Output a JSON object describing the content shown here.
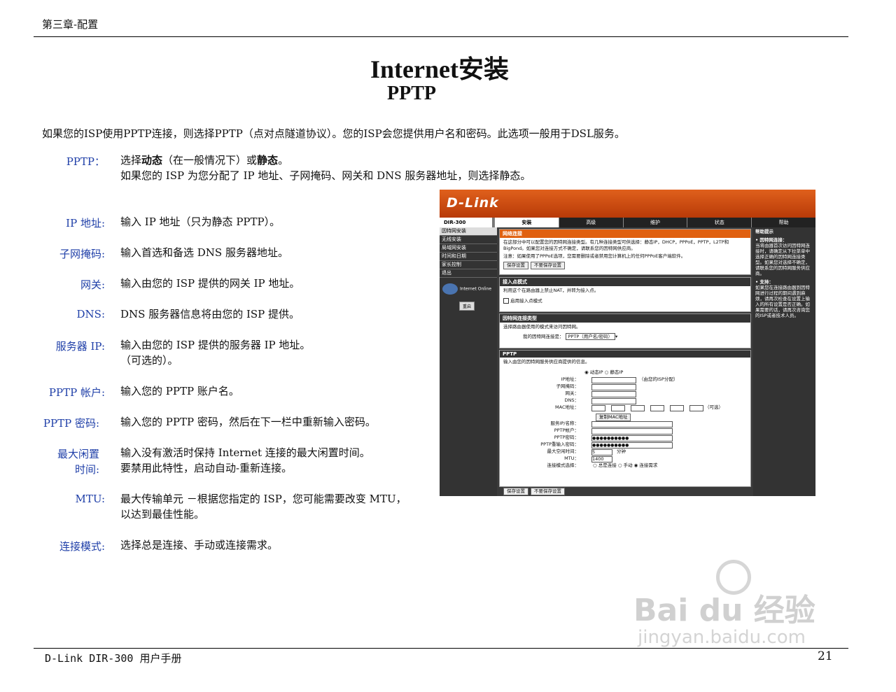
{
  "header": {
    "chapter": "第三章-配置"
  },
  "title": {
    "main": "Internet安装",
    "sub": "PPTP"
  },
  "intro": "如果您的ISP使用PPTP连接，则选择PPTP（点对点隧道协议）。您的ISP会您提供用户名和密码。此选项一般用于DSL服务。",
  "items": [
    {
      "label": "PPTP：",
      "line1_pre": "选择",
      "line1_b1": "动态",
      "line1_mid": "（在一般情况下）或",
      "line1_b2": "静态",
      "line1_post": "。",
      "line2": "如果您的 ISP 为您分配了 IP 地址、子网掩码、网关和 DNS 服务器地址，则选择静态。"
    },
    {
      "label": "IP 地址:",
      "text": "输入 IP 地址（只为静态 PPTP）。"
    },
    {
      "label": "子网掩码:",
      "text": "输入首选和备选 DNS 服务器地址。"
    },
    {
      "label": "网关:",
      "text": "输入由您的 ISP 提供的网关 IP 地址。"
    },
    {
      "label": "DNS:",
      "text": "DNS 服务器信息将由您的 ISP 提供。"
    },
    {
      "label": "服务器 IP:",
      "text": "输入由您的 ISP 提供的服务器 IP 地址。",
      "text2": "（可选的）。"
    },
    {
      "label": "PPTP 帐户:",
      "text": "输入您的 PPTP 账户名。"
    },
    {
      "label": "PPTP 密码:",
      "text": "输入您的 PPTP 密码，然后在下一栏中重新输入密码。"
    },
    {
      "label": "最大闲置",
      "label2": "时间:",
      "text": "输入没有激活时保持 Internet 连接的最大闲置时间。",
      "text2": "要禁用此特性，启动自动-重新连接。"
    },
    {
      "label": "MTU:",
      "text": "最大传输单元 －根据您指定的 ISP，您可能需要改变 MTU，",
      "text2": "以达到最佳性能。"
    },
    {
      "label": "连接模式:",
      "text": "选择总是连接、手动或连接需求。"
    }
  ],
  "footer": {
    "manual": "D-Link DIR-300 用户手册",
    "page": "21"
  },
  "watermark": {
    "brand": "Bai du 经验",
    "url": "jingyan.baidu.com"
  },
  "router": {
    "logo": "D-Link",
    "model": "DIR-300",
    "tabs": [
      "安装",
      "高级",
      "维护",
      "状态",
      "帮助"
    ],
    "nav": [
      "因特网安装",
      "无线安装",
      "局域网安装",
      "时间和日期",
      "家长控制",
      "退出"
    ],
    "online": "Internet Online",
    "home": "重启",
    "net": {
      "head": "网络连接",
      "text": "在这部分中可以配置您的因特网连接类型。有几种连接类型可供选择：静态IP，DHCP，PPPoE，PPTP，L2TP和BigPond。如果您对连接方式不确定，请联系您的因特网供应商。",
      "note": "注意：如果使用了PPPoE选项，您需要删除或者禁用您计算机上的任何PPPoE客户端软件。",
      "save": "保存设置",
      "nosave": "不要保存设置"
    },
    "ap": {
      "head": "接入点模式",
      "text": "利用这个在路由器上禁止NAT，并转为接入点。",
      "check": "启用接入点模式"
    },
    "type": {
      "head": "因特网连接类型",
      "text": "选择路由器使用的模式来访问因特网。",
      "label": "我的因特网连接是：",
      "value": "PPTP（用户名/密码）"
    },
    "pptp": {
      "head": "PPTP",
      "text": "输入由您的因特网服务供应商提供的信息。",
      "dyn": "动态IP",
      "static": "静态IP",
      "fields": [
        "IP地址：",
        "子网掩码：",
        "网关：",
        "DNS：",
        "MAC地址：",
        "服务IP/名称：",
        "PPTP帐户：",
        "PPTP密码：",
        "PPTP重输入密码：",
        "最大空闲时间：",
        "MTU：",
        "连接模式选择："
      ],
      "ipnote": "（由您的ISP分配）",
      "mac_opt": "（可选）",
      "clone": "复制MAC地址",
      "pwd": "●●●●●●●●●●",
      "idle": "5",
      "minute": "分钟",
      "mtu": "1400",
      "modes": [
        "总是连接",
        "手动",
        "连接需求"
      ],
      "save": "保存设置",
      "nosave": "不要保存设置"
    },
    "help": {
      "head": "帮助提示",
      "t1": "• 因特网连接：",
      "p1": "当将由器首次访问因特网连接时，请确定从下拉菜单中选择正确的因特网连接类型。如果您对选择不确定，请联系您的因特网服务供应商。",
      "t2": "• 支持：",
      "p2": "如果您在连接路由器到因特网进行过程的期间遇到麻烦，请再次检查在设置上输入的所有设置是否正确。如果需要的话，请再次咨询您的ISP或者技术人员。"
    }
  }
}
